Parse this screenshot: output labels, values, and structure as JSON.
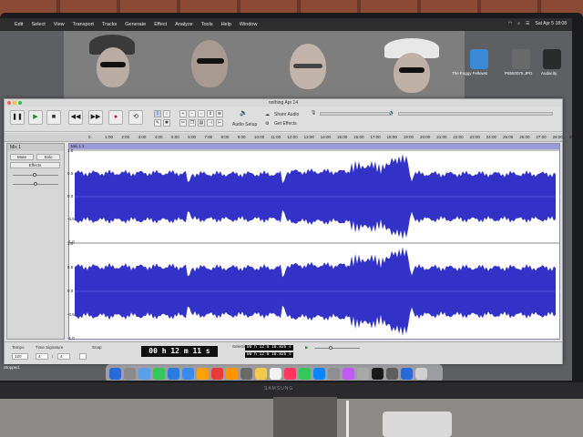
{
  "menubar": {
    "items": [
      "Edit",
      "Select",
      "View",
      "Transport",
      "Tracks",
      "Generate",
      "Effect",
      "Analyze",
      "Tools",
      "Help",
      "Window"
    ],
    "clock": "Sat Apr 5  18:08"
  },
  "desktop": {
    "icons": [
      {
        "label": "The Foggy Fellows!",
        "color": "#3a8ad6"
      },
      {
        "label": "P6550075.JPG",
        "color": "#6a6a6a"
      },
      {
        "label": "Audacity",
        "color": "#2b2b2b"
      }
    ]
  },
  "window": {
    "title": "nothing Apr 14",
    "toolbar": {
      "buttons": [
        "❚❚",
        "▶",
        "■",
        "◀◀",
        "▶▶",
        "●",
        "⟲"
      ],
      "audio_setup": "Audio Setup",
      "share_audio": "Share Audio",
      "get_effects": "Get Effects"
    },
    "ruler_ticks": [
      "0",
      "1:00",
      "2:00",
      "3:00",
      "4:00",
      "5:00",
      "6:00",
      "7:00",
      "8:00",
      "9:00",
      "10:00",
      "11:00",
      "12:00",
      "13:00",
      "14:00",
      "15:00",
      "16:00",
      "17:00",
      "18:00",
      "19:00",
      "20:00",
      "21:00",
      "22:00",
      "23:00",
      "24:00",
      "25:00",
      "26:00",
      "27:00",
      "28:00",
      "29:00"
    ],
    "track": {
      "name": "Mix 1",
      "mute": "Mute",
      "solo": "Solo",
      "effects": "Effects",
      "clip_name": "Mix 1.1",
      "scale_top": [
        "1.0",
        "0.5",
        "0.0",
        "-0.5",
        "-1.0"
      ],
      "scale_bottom": [
        "1.0",
        "0.5",
        "0.0",
        "-0.5",
        "-1.0"
      ],
      "wave_color": "#3232c8"
    },
    "bottom": {
      "tempo_label": "Tempo",
      "tempo_value": "120",
      "time_sig_label": "Time Signature",
      "time_sig_num": "4",
      "time_sig_den": "4",
      "snap_label": "Snap",
      "time_display": "00 h 12 m 11 s",
      "selection_label": "Selection",
      "selection_start": "00 h 12 m 10.826 s",
      "selection_end": "00 h 12 m 10.826 s"
    },
    "status": "Stopped."
  },
  "monitor_brand": "SAMSUNG",
  "dock_colors": [
    "#2a6ad6",
    "#8a8a8a",
    "#5aa0e8",
    "#34c759",
    "#2a7ae0",
    "#3a8af0",
    "#ff9f0a",
    "#e83a3a",
    "#ff9500",
    "#6a6a6a",
    "#f2c94c",
    "#f2f2f2",
    "#ff375f",
    "#34c759",
    "#0a84ff",
    "#8e8e93",
    "#bf5af2",
    "#a8a8a8",
    "#1a1a1a",
    "#5e5e5e",
    "#2a6ad6",
    "#d0d0d0"
  ]
}
